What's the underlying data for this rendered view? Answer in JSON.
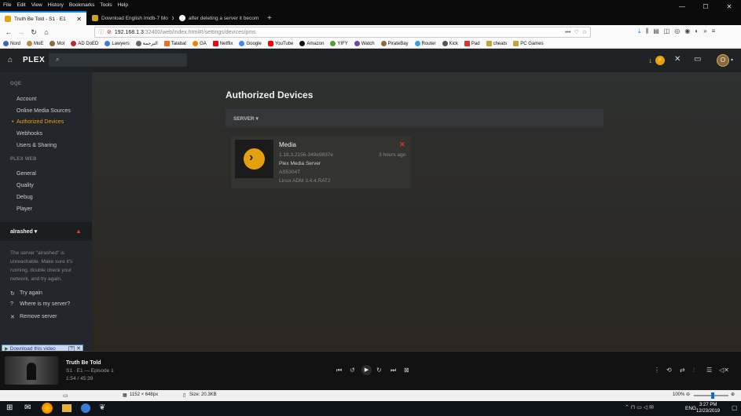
{
  "menubar": [
    "File",
    "Edit",
    "View",
    "History",
    "Bookmarks",
    "Tools",
    "Help"
  ],
  "tabs": [
    {
      "title": "Truth Be Told - S1 · E1",
      "active": true
    },
    {
      "title": "Download English Imdb-7 Mo",
      "active": false
    },
    {
      "title": "after deleting a server it becom",
      "active": false
    }
  ],
  "url": {
    "host": "192.168.1.3",
    "rest": ":32400/web/index.html#!/settings/devices/pms"
  },
  "bookmarks": [
    "Nord",
    "MoE",
    "MoI",
    "AD DoED",
    "Lawyers",
    "الترجمة",
    "Talabat",
    "GA",
    "Netflix",
    "Google",
    "YouTube",
    "Amazon",
    "YIFY",
    "Watch",
    "PirateBay",
    "Router",
    "Kick",
    "Pad",
    "cheats",
    "PC Games"
  ],
  "plex": {
    "logo": "PLEX",
    "notif_count": "1",
    "avatar_letter": "O"
  },
  "sidebar": {
    "server_head": "OQE",
    "server_items": [
      "Account",
      "Online Media Sources",
      "Authorized Devices",
      "Webhooks",
      "Users & Sharing"
    ],
    "active_index": 2,
    "web_head": "PLEX WEB",
    "web_items": [
      "General",
      "Quality",
      "Debug",
      "Player"
    ],
    "user": "alrashed ▾",
    "error_text": "The server \"alrashed\" is unreachable. Make sure it's running, double check your network, and try again.",
    "actions": [
      "Try again",
      "Where is my server?",
      "Remove server"
    ]
  },
  "main": {
    "title": "Authorized Devices",
    "filter": "SERVER",
    "device": {
      "name": "Media",
      "version": "1.18.3.2156-349e9837e",
      "time": "3 hours ago",
      "product": "Plex Media Server",
      "model": "AS5304T",
      "platform": "Linux ADM 3.4.4.RAT2"
    }
  },
  "overlay": {
    "download": "Download this video",
    "help": "?"
  },
  "player": {
    "title": "Truth Be Told",
    "episode": "S1 · E1 — Episode 1",
    "time": "1:54 / 45:39"
  },
  "status": {
    "dims": "1152 × 648px",
    "size": "Size: 20.3KB",
    "zoom": "100%"
  },
  "taskbar": {
    "lang": "ENG",
    "time": "3:27 PM",
    "date": "12/23/2019"
  },
  "colors": {
    "accent": "#e5a00d",
    "error": "#e5342a",
    "sidebar": "#23272b"
  }
}
